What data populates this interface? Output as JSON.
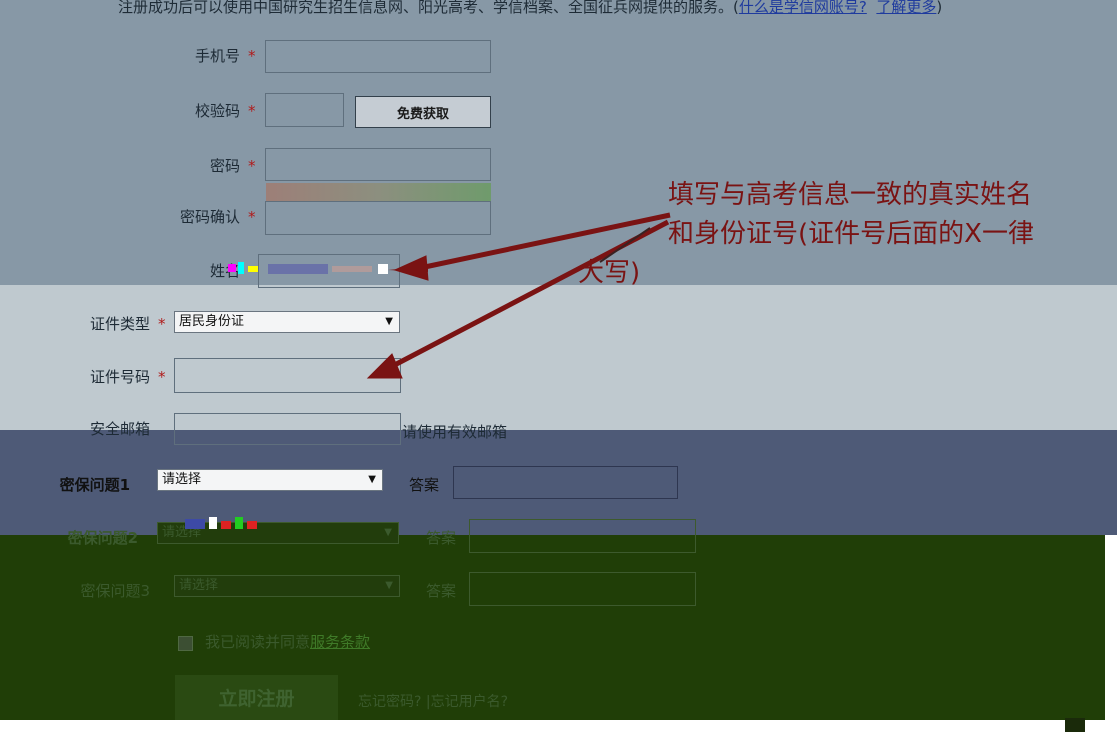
{
  "notice": {
    "prefix": "注册成功后可以使用中国研究生招生信息网、阳光高考、学信档案、全国征兵网提供的服务。(",
    "link1": "什么是学信网账号?",
    "link2": "了解更多",
    "suffix": ")"
  },
  "form": {
    "phone_label": "手机号",
    "code_label": "校验码",
    "get_code_button": "免费获取",
    "password_label": "密码",
    "confirm_label": "密码确认",
    "name_label": "姓名",
    "id_type_label": "证件类型",
    "id_type_value": "居民身份证",
    "id_number_label": "证件号码",
    "email_label": "安全邮箱",
    "email_hint": "请使用有效邮箱",
    "q1_label": "密保问题1",
    "q1_value": "请选择",
    "a1_label": "答案",
    "q2_label": "密保问题2",
    "q2_value": "请选择",
    "a2_label": "答案",
    "q3_label": "密保问题3",
    "q3_value": "请选择",
    "a3_label": "答案",
    "agree_text": "我已阅读并同意",
    "terms_link": "服务条款",
    "submit_button": "立即注册",
    "forgot_password": "忘记密码?",
    "forgot_separator": "|",
    "forgot_username": "忘记用户名?",
    "required_mark": "*"
  },
  "annotation": {
    "line1": "填写与高考信息一致的真实姓名",
    "line2": "和身份证号(证件号后面的X一律",
    "line3": "大写)",
    "color": "#7a1313"
  },
  "colors": {
    "band_top": "#8798a6",
    "band_mid": "#bfc9cf",
    "band_blue": "#4e5a77",
    "band_green": "#203e07"
  }
}
